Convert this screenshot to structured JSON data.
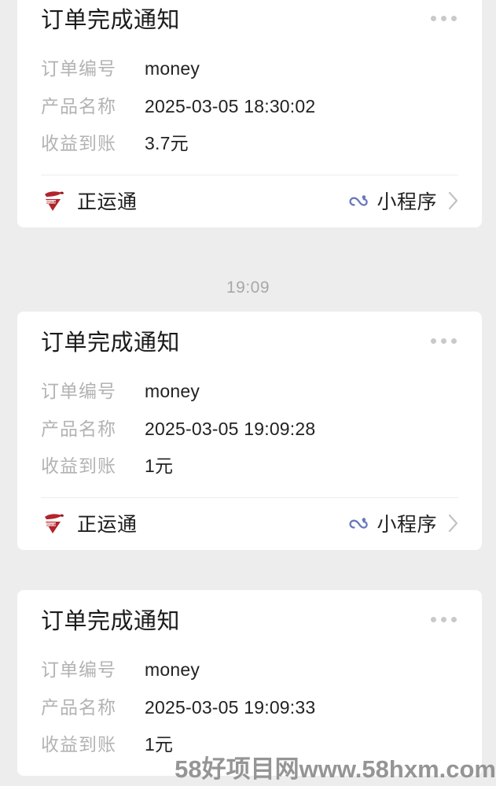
{
  "meta": {
    "background_color": "#ededed",
    "card_color": "#ffffff",
    "label_color": "#b3b3b3",
    "value_color": "#222222",
    "brand_red": "#b3232a",
    "mini_program_blue": "#5b6fb5"
  },
  "messages": [
    {
      "title": "订单完成通知",
      "more_icon": "more-dots-icon",
      "rows": [
        {
          "label": "订单编号",
          "value": "money"
        },
        {
          "label": "产品名称",
          "value": "2025-03-05 18:30:02"
        },
        {
          "label": "收益到账",
          "value": "3.7元"
        }
      ],
      "footer": {
        "logo_icon": "zhengyuntong-logo-icon",
        "app_name": "正运通",
        "mini_icon": "mini-program-icon",
        "mini_label": "小程序",
        "chevron_icon": "chevron-right-icon"
      }
    },
    {
      "title": "订单完成通知",
      "more_icon": "more-dots-icon",
      "rows": [
        {
          "label": "订单编号",
          "value": "money"
        },
        {
          "label": "产品名称",
          "value": "2025-03-05 19:09:28"
        },
        {
          "label": "收益到账",
          "value": "1元"
        }
      ],
      "footer": {
        "logo_icon": "zhengyuntong-logo-icon",
        "app_name": "正运通",
        "mini_icon": "mini-program-icon",
        "mini_label": "小程序",
        "chevron_icon": "chevron-right-icon"
      }
    },
    {
      "title": "订单完成通知",
      "more_icon": "more-dots-icon",
      "rows": [
        {
          "label": "订单编号",
          "value": "money"
        },
        {
          "label": "产品名称",
          "value": "2025-03-05 19:09:33"
        },
        {
          "label": "收益到账",
          "value": "1元"
        }
      ],
      "footer": null
    }
  ],
  "time_divider": {
    "label": "19:09"
  },
  "watermark": {
    "text": "58好项目网www.58hxm.com"
  }
}
